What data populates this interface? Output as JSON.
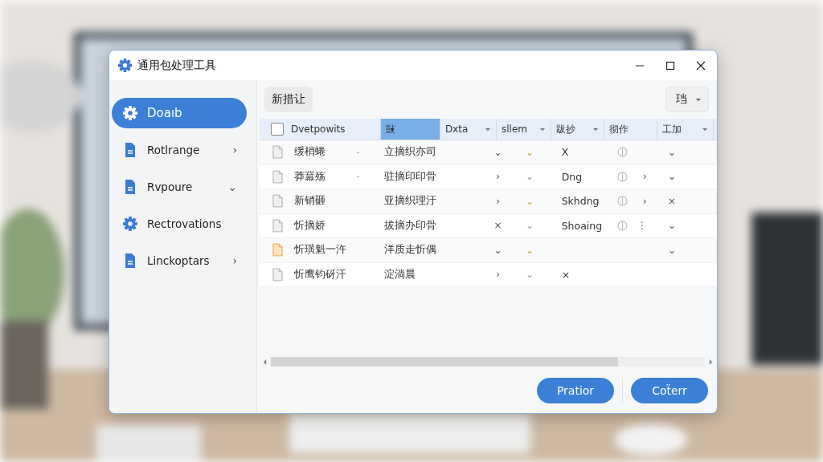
{
  "window": {
    "title": "通用包处理工具"
  },
  "sidebar": {
    "items": [
      {
        "label": "Doaıb",
        "kind": "gear",
        "selected": true
      },
      {
        "label": "Rotlrange",
        "kind": "doc",
        "selected": false,
        "arrow": "›"
      },
      {
        "label": "Rvpoure",
        "kind": "doc",
        "selected": false,
        "arrow": "⌄"
      },
      {
        "label": "Rectrovations",
        "kind": "gear",
        "selected": false
      },
      {
        "label": "Linckoptars",
        "kind": "doc",
        "selected": false,
        "arrow": "›"
      }
    ]
  },
  "toolbar": {
    "button": "新措让",
    "dropdown": "珰"
  },
  "table": {
    "columns": [
      {
        "label": "Dvetpowits",
        "selected": false,
        "arrow": false
      },
      {
        "label": "敱",
        "selected": true,
        "arrow": false
      },
      {
        "label": "Dxta",
        "selected": false,
        "arrow": true
      },
      {
        "label": "sllem",
        "selected": false,
        "arrow": true
      },
      {
        "label": "跋抄",
        "selected": false,
        "arrow": true
      },
      {
        "label": "彻作",
        "selected": false,
        "arrow": false
      },
      {
        "label": "工加",
        "selected": false,
        "arrow": true
      }
    ],
    "rows": [
      {
        "name": "缓梢蜷",
        "dash": "-",
        "desc": "立摘织亦司",
        "c3": "⌄",
        "c4": "⌄",
        "c4_highlight": true,
        "c5": "X",
        "info": true,
        "c7": "⌄",
        "file_highlight": false
      },
      {
        "name": "莽羃殇",
        "dash": "-",
        "desc": "驻摘印印骨",
        "c3": "›",
        "c4": "⌄",
        "c4_highlight": false,
        "c5": "Dng",
        "info": true,
        "c6": "›",
        "c7": "⌄",
        "file_highlight": false
      },
      {
        "name": "新销砸",
        "desc": "亚摘织理汙",
        "c3": "›",
        "c4": "⌄",
        "c4_highlight": true,
        "c5": "Skhdng",
        "info": true,
        "c6": "›",
        "c7": "×",
        "file_highlight": false
      },
      {
        "name": "忻摘娇",
        "desc": "拔摘办印骨",
        "c3": "×",
        "c4": "⌄",
        "c4_highlight": false,
        "c5": "Shoaing",
        "info": true,
        "c6": "⋮",
        "c7": "⌄",
        "file_highlight": false
      },
      {
        "name": "忻璜魁一汻",
        "desc": "洋质走忻偶",
        "c3": "⌄",
        "c4": "⌄",
        "c4_highlight": true,
        "info": false,
        "c7": "⌄",
        "file_highlight": true
      },
      {
        "name": "忻鹰钧砑汗",
        "desc": "淀淌晨",
        "c3": "›",
        "c4": "⌄",
        "c4_highlight": false,
        "c5": "×",
        "info": false,
        "file_highlight": false
      }
    ]
  },
  "buttons": [
    "Pratior",
    "Coẗerr"
  ]
}
